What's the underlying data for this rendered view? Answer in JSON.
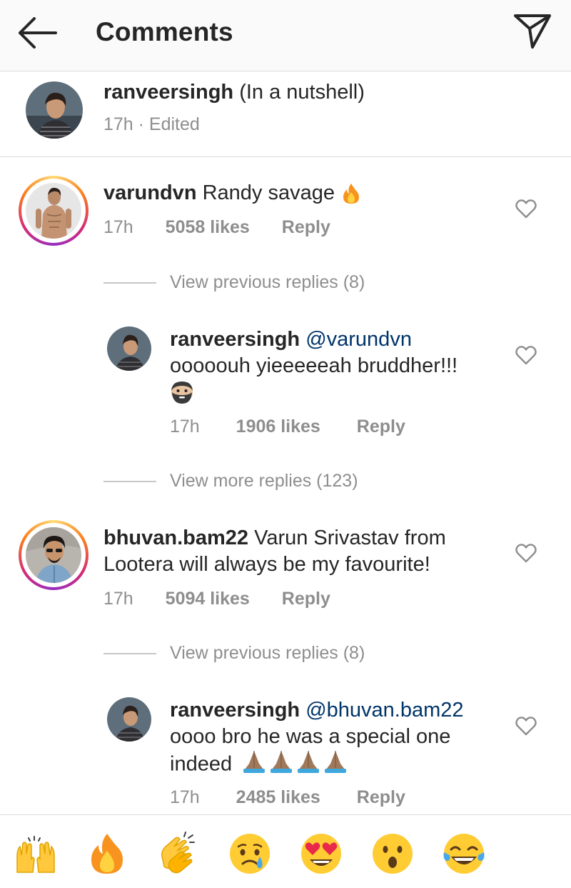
{
  "header": {
    "title": "Comments"
  },
  "caption": {
    "username": "ranveersingh",
    "text": "(In a nutshell)",
    "meta": "17h · Edited"
  },
  "comments": [
    {
      "username": "varundvn",
      "text": "Randy savage",
      "emoji": "fire-icon",
      "time": "17h",
      "likes": "5058 likes",
      "reply": "Reply",
      "view_replies": "View previous replies (8)",
      "replies": [
        {
          "username": "ranveersingh",
          "mention": "@varundvn",
          "text": "ooooouh yieeeeeah bruddher!!!",
          "emoji": "bearded-face-icon",
          "time": "17h",
          "likes": "1906 likes",
          "reply": "Reply"
        }
      ],
      "view_more": "View more replies (123)"
    },
    {
      "username": "bhuvan.bam22",
      "text_line1": "Varun Srivastav from",
      "text_line2": "Lootera will always be my favourite!",
      "time": "17h",
      "likes": "5094 likes",
      "reply": "Reply",
      "view_replies": "View previous replies (8)",
      "replies": [
        {
          "username": "ranveersingh",
          "mention": "@bhuvan.bam22",
          "text_line1": "oooo bro he was a special one",
          "text_line2": "indeed",
          "emoji": "folded-hands-icon",
          "time": "17h",
          "likes": "2485 likes",
          "reply": "Reply"
        }
      ]
    }
  ],
  "emoji_bar": [
    "raising-hands-icon",
    "fire-icon",
    "clapping-hands-icon",
    "crying-face-icon",
    "heart-eyes-icon",
    "surprised-face-icon",
    "tears-of-joy-icon"
  ],
  "colors": {
    "text": "#262626",
    "secondary": "#8e8e8e",
    "mention": "#003569",
    "divider": "#dbdbdb"
  }
}
